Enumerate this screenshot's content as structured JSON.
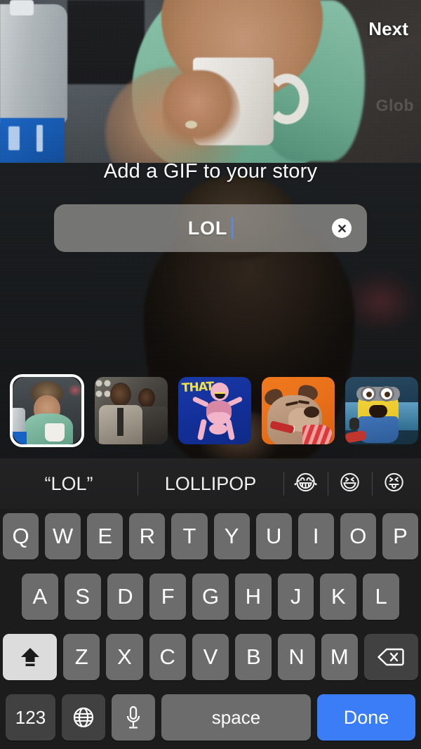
{
  "header": {
    "next_label": "Next"
  },
  "gif_picker": {
    "title": "Add a GIF to your story",
    "search": {
      "value": "LOL",
      "clear_icon": "clear-circle-icon"
    },
    "results": [
      {
        "name": "woman-laughing-coffee-gif",
        "selected": true,
        "alt": "Woman in green tank top laughing over coffee mug"
      },
      {
        "name": "two-men-suits-gif",
        "selected": false,
        "alt": "Two men in suits reacting"
      },
      {
        "name": "that-skeleton-gif",
        "selected": false,
        "alt": "Pink skeleton laughing with THAT text on blue"
      },
      {
        "name": "muttley-dog-gif",
        "selected": false,
        "alt": "Cartoon dog snickering on orange background"
      },
      {
        "name": "minion-laughing-gif",
        "selected": false,
        "alt": "Minion laughing on ice"
      }
    ]
  },
  "keyboard": {
    "suggestions": [
      {
        "text": "“LOL”",
        "type": "quoted"
      },
      {
        "text": "LOLLIPOP",
        "type": "word"
      },
      {
        "text": "😂",
        "type": "emoji"
      },
      {
        "text": "😆",
        "type": "emoji"
      },
      {
        "text": "😝",
        "type": "emoji"
      }
    ],
    "row1": [
      "Q",
      "W",
      "E",
      "R",
      "T",
      "Y",
      "U",
      "I",
      "O",
      "P"
    ],
    "row2": [
      "A",
      "S",
      "D",
      "F",
      "G",
      "H",
      "J",
      "K",
      "L"
    ],
    "row3": [
      "Z",
      "X",
      "C",
      "V",
      "B",
      "N",
      "M"
    ],
    "shift": {
      "label": "",
      "icon": "shift-up-arrow-icon",
      "active": true
    },
    "backspace": {
      "label": "",
      "icon": "backspace-delete-icon"
    },
    "numbers_key": "123",
    "globe_key": {
      "icon": "globe-language-icon"
    },
    "dictation_key": {
      "icon": "microphone-icon"
    },
    "space_key": "space",
    "return_key": "Done"
  },
  "colors": {
    "accent_blue": "#3b7df6",
    "keyboard_bg": "#1c1c1d",
    "key_bg": "#6c6c6c",
    "function_key_bg": "#414141",
    "shift_active_bg": "#dcdcdc",
    "text_white": "#ffffff"
  },
  "watermark": "Glob"
}
